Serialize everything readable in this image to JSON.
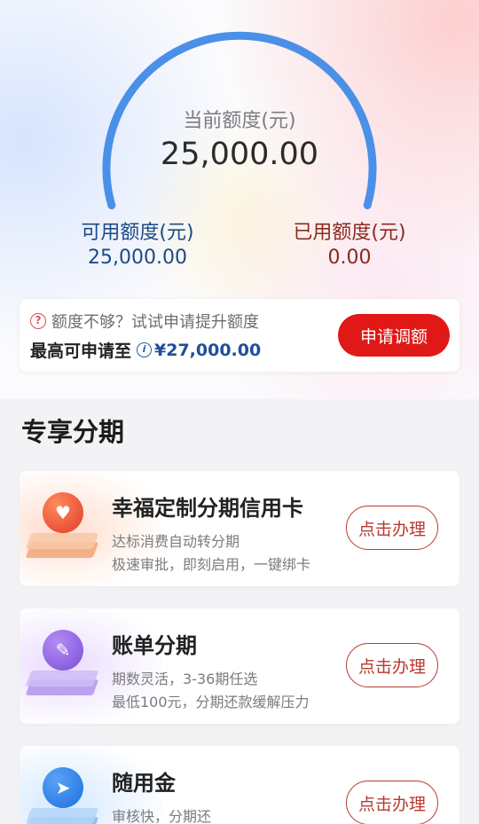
{
  "limit": {
    "current_label": "当前额度(元)",
    "current_value": "25,000.00",
    "available_label": "可用额度(元)",
    "available_value": "25,000.00",
    "used_label": "已用额度(元)",
    "used_value": "0.00",
    "gauge_fraction": 1.0
  },
  "raise": {
    "question_icon": "question-circle-icon",
    "question_text": "额度不够？试试申请提升额度",
    "max_label": "最高可申请至",
    "info_icon": "info-icon",
    "max_amount": "¥27,000.00",
    "apply_button": "申请调额"
  },
  "section": {
    "title": "专享分期"
  },
  "products": [
    {
      "title": "幸福定制分期信用卡",
      "desc1": "达标消费自动转分期",
      "desc2": "极速审批，即刻启用，一键绑卡",
      "button": "点击办理",
      "icon": "heart-icon"
    },
    {
      "title": "账单分期",
      "desc1": "期数灵活，3-36期任选",
      "desc2": "最低100元，分期还款缓解压力",
      "button": "点击办理",
      "icon": "pencil-icon"
    },
    {
      "title": "随用金",
      "desc1": "审核快，分期还",
      "button": "点击办理",
      "icon": "rocket-icon"
    }
  ],
  "colors": {
    "gauge_arc": "#4a90e8",
    "apply_red": "#e01917",
    "available_blue": "#1c4a86",
    "used_red": "#8a2a1c"
  }
}
